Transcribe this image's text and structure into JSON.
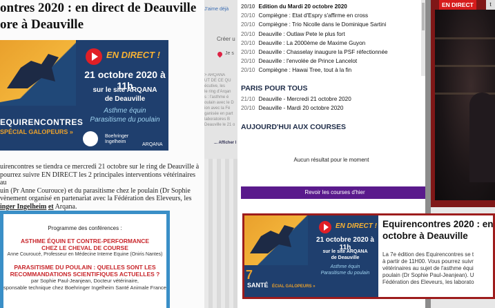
{
  "left_article": {
    "title_line1": "ontres 2020 : en direct de Deauville",
    "title_line2": "ore à Deauville",
    "banner": {
      "live": "EN DIRECT !",
      "date": "21 octobre 2020 à 11h",
      "site_line1": "sur le site ARQANA",
      "site_line2": "de Deauville",
      "topic_line1": "Asthme équin",
      "topic_line2": "Parasitisme du poulain",
      "brand": "EQUIRENCONTRES",
      "brand_sub": "SPÉCIAL GALOPEURS »",
      "sponsor1": "Boehringer Ingelheim",
      "sponsor2": "ARQANA"
    },
    "body_line1": "uirencontres se tiendra ce mercredi 21 octobre sur le ring de Deauville à",
    "body_line2": "pourrez suivre EN DIRECT les 2 principales interventions vétérinaires au",
    "body_line3": "uin (Pr Anne Courouce) et du parasitisme chez le poulain (Dr Sophie",
    "body_line4": "vènement organisé en partenariat avec la Fédération des Eleveurs, les",
    "body_link1": "inger Ingelheim",
    "body_link2": "et",
    "body_link3": "Arqana.",
    "program": {
      "heading": "Programme des conférences :",
      "talk1_line1": "ASTHME ÉQUIN ET CONTRE-PERFORMANCE",
      "talk1_line2": "CHEZ LE CHEVAL DE COURSE",
      "talk1_author": "Anne Couroucé, Professeur en Médecine Interne Equine (Oniris Nantes)",
      "talk2_line1": "PARASITISME DU POULAIN : QUELLES SONT LES",
      "talk2_line2": "RECOMMANDATIONS SCIENTIFIQUES ACTUELLES ?",
      "talk2_author1": "par Sophie Paul-Jeanjean, Docteur vétérinaire,",
      "talk2_author2": "sponsable technique chez Boehringer Ingelheim Santé Animale France"
    }
  },
  "middle": {
    "top_link": "J'aime déjà",
    "creer": "Créer u",
    "je": "Je s",
    "blur_lines": [
      "> ARQANA",
      "",
      "UT DE CE QU",
      "écutive, les",
      "le ring d'Arqan",
      "s : l'asthme é",
      "oulain avec le D",
      "ion avec la Fé",
      "ganisée en part",
      "laboratoires B",
      "Deauville le 21 o"
    ],
    "affiche": "... Afficher l"
  },
  "news": {
    "items": [
      {
        "date": "20/10",
        "text": "Edition du Mardi 20 octobre 2020",
        "bold": true
      },
      {
        "date": "20/10",
        "text": "Compiègne : Etat d'Espry s'affirme en cross"
      },
      {
        "date": "20/10",
        "text": "Compiègne : Trio Nicolle dans le Dominique Sartini"
      },
      {
        "date": "20/10",
        "text": "Deauville : Outlaw Pete le plus fort"
      },
      {
        "date": "20/10",
        "text": "Deauville : La 2000ème de Maxime Guyon"
      },
      {
        "date": "20/10",
        "text": "Deauville : Chasselay inaugure la PSF réfectionnée"
      },
      {
        "date": "20/10",
        "text": "Deauville : l'envolée de Prince Lancelot"
      },
      {
        "date": "20/10",
        "text": "Compiègne : Hawai Tree, tout à la fin"
      }
    ],
    "paris_title": "PARIS POUR TOUS",
    "paris_items": [
      {
        "date": "21/10",
        "text": "Deauville - Mercredi 21 octobre 2020"
      },
      {
        "date": "20/10",
        "text": "Deauville - Mardi 20 octobre 2020"
      }
    ],
    "today_title": "AUJOURD'HUI AUX COURSES",
    "empty_message": "Aucun résultat pour le moment",
    "yesterday_button": "Revoir les courses d'hier"
  },
  "video_card": {
    "title_line1": "Equirencontres 2020 : en",
    "title_line2": "octobre à Deauville",
    "body_line1": "La 7e édition des Equirencontres se t",
    "body_line2": "à partir de 11H00. Vous pourrez suivr",
    "body_line3": "vétérinaires au sujet de l'asthme équi",
    "body_line4": "poulain (Dr Sophie Paul-Jeanjean). U",
    "body_line5": "Fédération des Eleveurs, les laborato",
    "thumb": {
      "live": "EN DIRECT !",
      "date": "21 octobre 2020 à 11h",
      "site_line1": "sur le site ARQANA",
      "site_line2": "de Deauville",
      "topic_line1": "Asthme équin",
      "topic_line2": "Parasitisme du poulain",
      "big7": "7",
      "sante": "SANTÉ",
      "gal": "ÉCIAL GALOPEURS »"
    }
  },
  "video_pane": {
    "live_badge": "EN DIRECT",
    "badge_right": "t"
  }
}
